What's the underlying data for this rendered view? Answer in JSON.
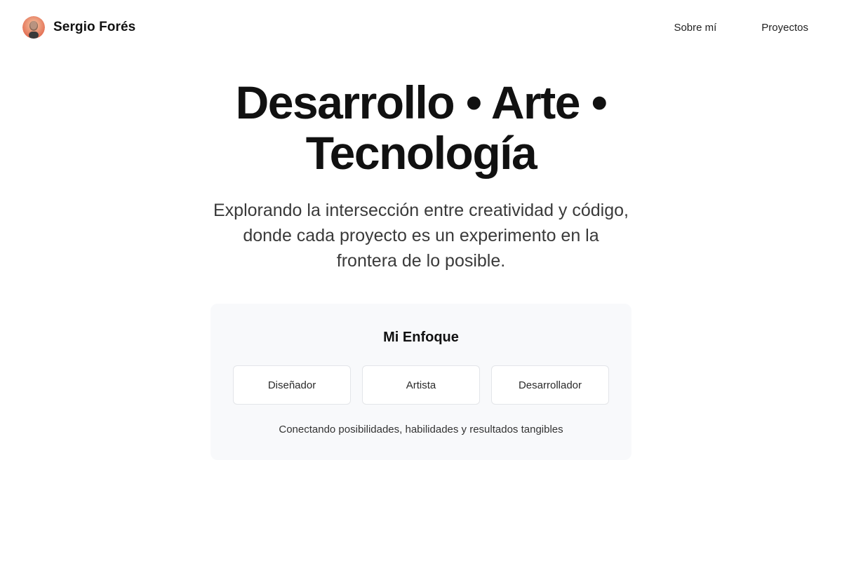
{
  "header": {
    "brand_name": "Sergio Forés",
    "avatar_icon": "profile-photo",
    "nav": [
      {
        "label": "Sobre mí"
      },
      {
        "label": "Proyectos"
      }
    ]
  },
  "hero": {
    "title": "Desarrollo • Arte • Tecnología",
    "subtitle": "Explorando la intersección entre creatividad y código, donde cada proyecto es un experimento en la frontera de lo posible."
  },
  "approach": {
    "title": "Mi Enfoque",
    "roles": [
      {
        "label": "Diseñador"
      },
      {
        "label": "Artista"
      },
      {
        "label": "Desarrollador"
      }
    ],
    "caption": "Conectando posibilidades, habilidades y resultados tangibles"
  },
  "colors": {
    "background": "#ffffff",
    "text": "#111111",
    "muted_text": "#3a3a3a",
    "card_background": "#f8f9fb",
    "role_border": "#e3e5e9"
  }
}
